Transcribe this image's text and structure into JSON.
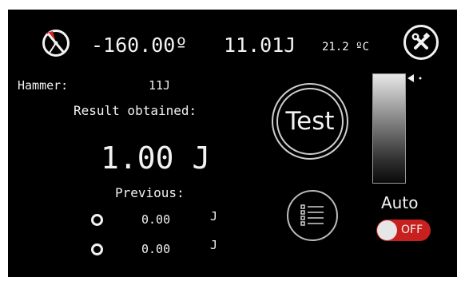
{
  "header": {
    "pendulum_icon": "pendulum-angle-icon",
    "angle": "-160.00º",
    "energy": "11.01J",
    "temperature": "21.2 ºC",
    "settings_icon": "wrench-screwdriver-icon"
  },
  "hammer": {
    "label": "Hammer:",
    "value": "11J"
  },
  "result": {
    "label": "Result obtained:",
    "value": "1.00 J"
  },
  "previous": {
    "label": "Previous:",
    "items": [
      {
        "value": "0.00",
        "unit": "J"
      },
      {
        "value": "0.00",
        "unit": "J"
      }
    ]
  },
  "test_button": {
    "label": "Test"
  },
  "history_button": {
    "icon": "list-icon"
  },
  "gauge": {
    "level": 0,
    "marker_icon": "arrow-left-icon"
  },
  "auto_mode": {
    "label": "Auto",
    "toggle_state": "OFF"
  },
  "colors": {
    "background": "#000000",
    "text": "#f2f2f2",
    "toggle_off": "#c8201e",
    "pendulum_accent": "#d9201c"
  }
}
